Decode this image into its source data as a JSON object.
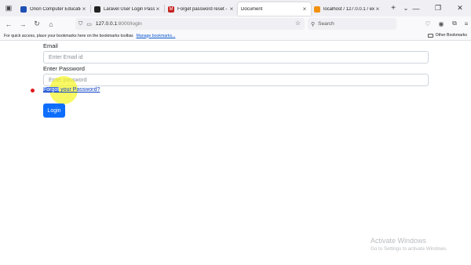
{
  "tabs": [
    {
      "title": "Orion Computer Education (C",
      "active": false,
      "favicon_color": "#1e4fb5"
    },
    {
      "title": "Laravel User Login Password",
      "active": false,
      "favicon_color": "#222222"
    },
    {
      "title": "Forget password reset - sndy",
      "active": false,
      "favicon_color": "#c5221f"
    },
    {
      "title": "Document",
      "active": true,
      "favicon_color": ""
    },
    {
      "title": "localhost / 127.0.0.1 / exam",
      "active": false,
      "favicon_color": "#f29111"
    }
  ],
  "url": {
    "host": "127.0.0.1",
    "path": ":8000/login"
  },
  "search": {
    "placeholder": "Search"
  },
  "bookmarks": {
    "hint": "For quick access, place your bookmarks here on the bookmarks toolbar.",
    "manage": "Manage bookmarks...",
    "other": "Other Bookmarks"
  },
  "form": {
    "email_label": "Email",
    "email_placeholder": "Enter Email id",
    "password_label": "Enter Password",
    "password_placeholder": "Enter password",
    "forgot_selected": "Forgot",
    "forgot_rest": " your Password?",
    "login_label": "Login"
  },
  "watermark": {
    "title": "Activate Windows",
    "subtitle": "Go to Settings to activate Windows."
  },
  "colors": {
    "accent": "#0d6efd",
    "link": "#0b3fc8",
    "cursor_highlight": "#f5f528"
  }
}
